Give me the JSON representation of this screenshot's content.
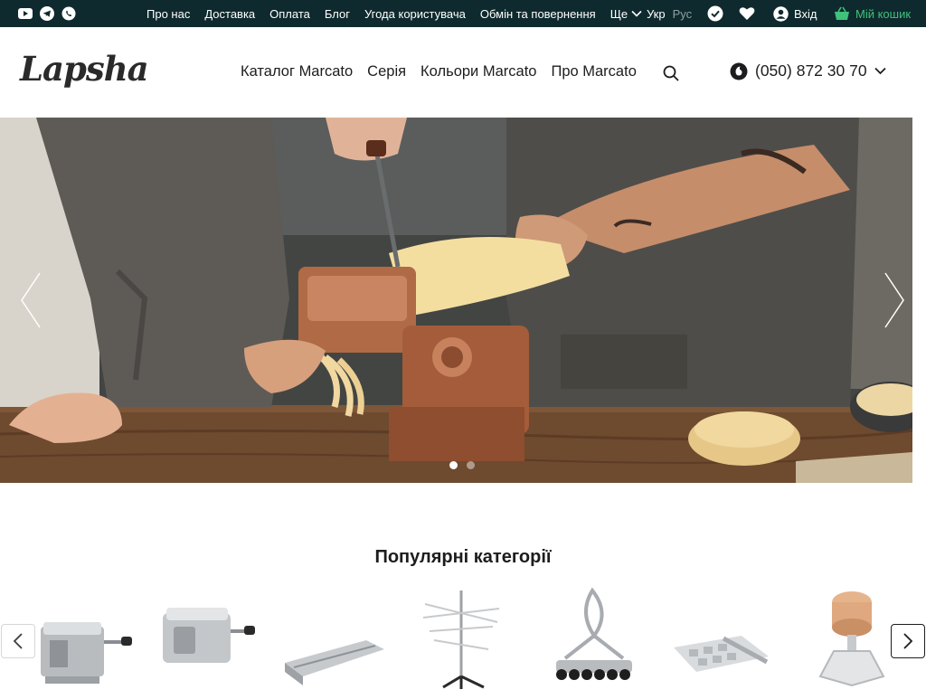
{
  "topbar": {
    "socials": [
      "youtube-icon",
      "telegram-icon",
      "viber-icon"
    ],
    "nav": [
      "Про нас",
      "Доставка",
      "Оплата",
      "Блог",
      "Угода користувача",
      "Обмін та повернення"
    ],
    "more_label": "Ще",
    "lang_active": "Укр",
    "lang_inactive": "Рус",
    "login_label": "Вхід",
    "cart_label": "Мій кошик"
  },
  "header": {
    "logo": "Lapsha",
    "nav": [
      "Каталог Marcato",
      "Серія",
      "Кольори Marcato",
      "Про Marcato"
    ],
    "phone": "(050) 872 30 70"
  },
  "hero": {
    "slide_count": 2,
    "active_slide": 1
  },
  "categories": {
    "title": "Популярні категорії",
    "items": [
      "pasta-machine-icon",
      "pasta-machine-wide-icon",
      "pasta-attachment-icon",
      "pasta-drying-rack-icon",
      "ravioli-cutter-icon",
      "ravioli-tray-icon",
      "ravioli-stamp-icon"
    ]
  },
  "colors": {
    "topbar_bg": "#0f2a2e",
    "cart_green": "#3fc27a",
    "text_dark": "#1d1d1f"
  }
}
